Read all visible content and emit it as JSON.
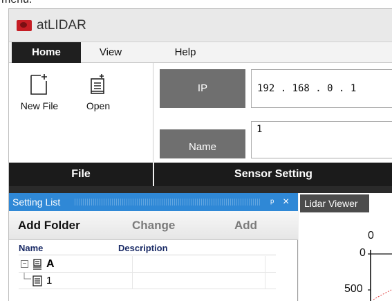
{
  "top_caption": "menu.",
  "app": {
    "title": "atLIDAR"
  },
  "menu": {
    "home": "Home",
    "view": "View",
    "help": "Help"
  },
  "ribbon": {
    "new_file": "New File",
    "open": "Open",
    "file_group": "File",
    "sensor_group": "Sensor Setting",
    "ip_label": "IP",
    "ip_value": "192 . 168 .  0  .  1",
    "name_label": "Name",
    "name_value": "1"
  },
  "setting_list": {
    "title": "Setting List",
    "pin": "ᵖ",
    "close": "×",
    "add_folder": "Add Folder",
    "change": "Change",
    "add": "Add",
    "col_name": "Name",
    "col_description": "Description",
    "rows": [
      {
        "expander": "−",
        "name": "A",
        "icon": "device-icon"
      },
      {
        "name": "1",
        "icon": "list-icon"
      }
    ]
  },
  "viewer": {
    "tab": "Lidar Viewer",
    "axis_top": "0",
    "tick_0": "0",
    "tick_500": "500"
  },
  "colors": {
    "panel_header": "#2f88d6",
    "brand_red": "#c51d24",
    "dark_bar": "#1b1b1b",
    "field_label": "#6f6f6f"
  }
}
